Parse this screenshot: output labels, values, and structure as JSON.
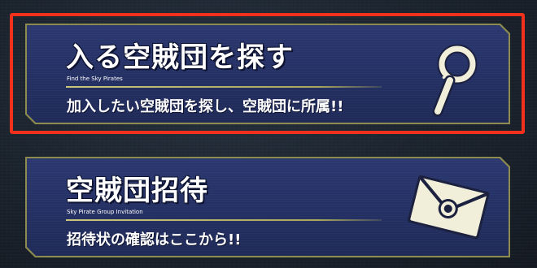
{
  "menu": {
    "items": [
      {
        "title": "入る空賊団を探す",
        "subtitle": "Find the Sky Pirates",
        "description": "加入したい空賊団を探し、空賊団に所属!!",
        "icon": "magnifier-icon",
        "selected": true
      },
      {
        "title": "空賊団招待",
        "subtitle": "Sky Pirate Group Invitation",
        "description": "招待状の確認はここから!!",
        "icon": "envelope-icon",
        "selected": false
      }
    ]
  },
  "colors": {
    "panel_fill": "#263266",
    "panel_border": "#8d8c4e",
    "selection_outline": "#f2311c",
    "icon_fill": "#f1efd9",
    "background": "#1b232d"
  }
}
